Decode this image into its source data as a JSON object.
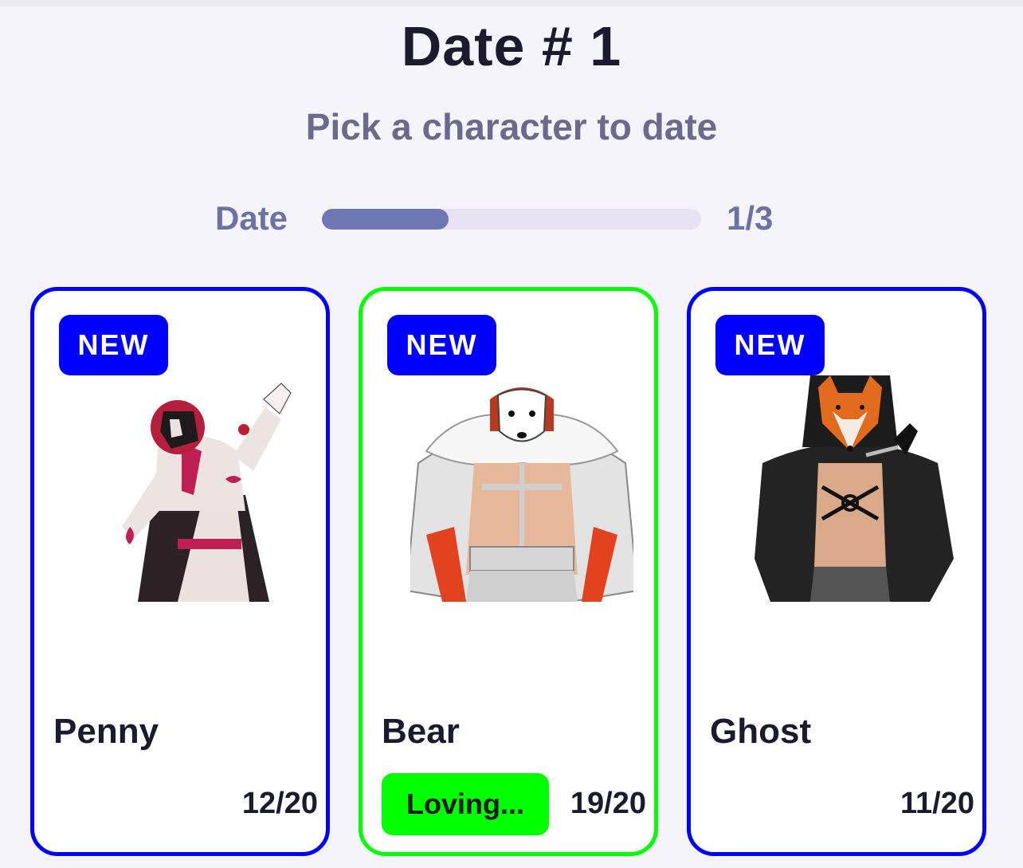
{
  "header": {
    "title": "Date # 1",
    "subtitle": "Pick a character to date"
  },
  "progress": {
    "label": "Date",
    "count_text": "1/3",
    "current": 1,
    "total": 3
  },
  "colors": {
    "accent_blue": "#0000ff",
    "selected_green": "#00ff00",
    "progress_fill": "#6e76b3"
  },
  "cards": [
    {
      "badge": "NEW",
      "name": "Penny",
      "score": "12/20",
      "selected": false,
      "portrait_icon": "masked-character-portrait"
    },
    {
      "badge": "NEW",
      "name": "Bear",
      "score": "19/20",
      "selected": true,
      "status": "Loving...",
      "portrait_icon": "polar-bear-mask-portrait"
    },
    {
      "badge": "NEW",
      "name": "Ghost",
      "score": "11/20",
      "selected": false,
      "portrait_icon": "fox-mask-portrait"
    }
  ]
}
